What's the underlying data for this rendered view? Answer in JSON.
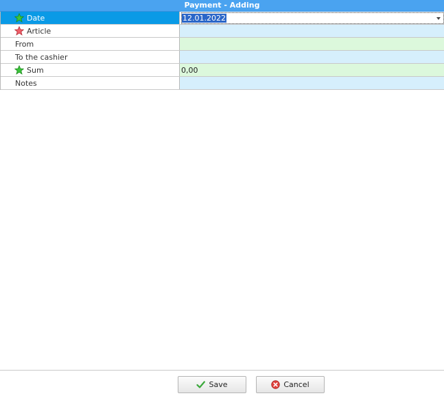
{
  "window": {
    "title": "Payment - Adding"
  },
  "fields": [
    {
      "label": "Date",
      "value": "12.01.2022",
      "icon": "green-star-icon",
      "required": "green"
    },
    {
      "label": "Article",
      "value": "",
      "icon": "red-star-icon",
      "required": "red"
    },
    {
      "label": "From",
      "value": ""
    },
    {
      "label": "To the cashier",
      "value": ""
    },
    {
      "label": "Sum",
      "value": "0,00",
      "icon": "green-star-icon",
      "required": "green"
    },
    {
      "label": "Notes",
      "value": ""
    }
  ],
  "buttons": {
    "save_label": "Save",
    "cancel_label": "Cancel"
  },
  "colors": {
    "title_bar": "#4aa3f0",
    "selected_row": "#0a9ae6",
    "value_green": "#dcf8dc",
    "value_blue": "#d6effc"
  }
}
